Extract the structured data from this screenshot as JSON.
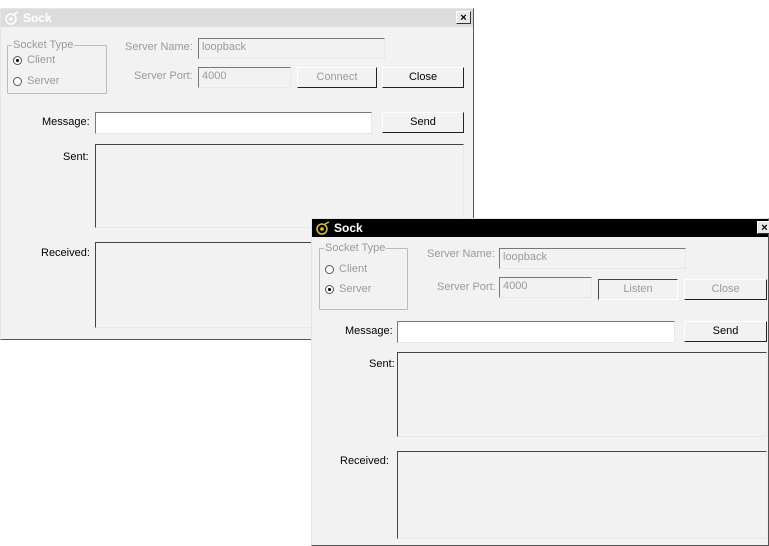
{
  "windows": [
    {
      "title": "Sock",
      "close_glyph": "×",
      "socket_type_label": "Socket Type",
      "client_label": "Client",
      "server_label": "Server",
      "client_selected": true,
      "server_name_label": "Server Name:",
      "server_name_value": "loopback",
      "server_port_label": "Server Port:",
      "server_port_value": "4000",
      "action_button": "Connect",
      "close_button": "Close",
      "message_label": "Message:",
      "message_value": "",
      "send_button": "Send",
      "sent_label": "Sent:",
      "received_label": "Received:"
    },
    {
      "title": "Sock",
      "close_glyph": "×",
      "socket_type_label": "Socket Type",
      "client_label": "Client",
      "server_label": "Server",
      "server_selected": true,
      "server_name_label": "Server Name:",
      "server_name_value": "loopback",
      "server_port_label": "Server Port:",
      "server_port_value": "4000",
      "action_button": "Listen",
      "close_button": "Close",
      "message_label": "Message:",
      "message_value": "",
      "send_button": "Send",
      "sent_label": "Sent:",
      "received_label": "Received:"
    }
  ],
  "icons": {
    "app": "sock-app-icon",
    "close": "close-icon"
  }
}
